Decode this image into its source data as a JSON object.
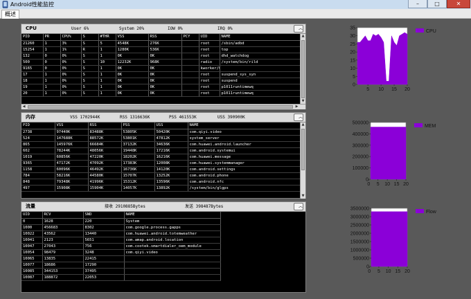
{
  "window": {
    "title": "Android性能监控",
    "btn_min": "–",
    "btn_max": "□",
    "btn_close": "✕"
  },
  "tabs": [
    {
      "label": "概述"
    }
  ],
  "cpu_panel": {
    "title": "CPU",
    "user": "User 6%",
    "system": "System 20%",
    "iow": "IOW 0%",
    "irq": "IRQ 0%",
    "columns": [
      "PID",
      "PR",
      "CPU%",
      "S",
      "#THR",
      "VSS",
      "RSS",
      "PCY",
      "UID",
      "NAME"
    ],
    "rows": [
      [
        "21260",
        "1",
        "3%",
        "S",
        "5",
        "4548K",
        "276K",
        "",
        "root",
        "/sbin/adbd"
      ],
      [
        "15254",
        "1",
        "1%",
        "R",
        "1",
        "1280K",
        "536K",
        "",
        "root",
        "top"
      ],
      [
        "132",
        "0",
        "0%",
        "S",
        "1",
        "0K",
        "0K",
        "",
        "root",
        "dhd_watchdog"
      ],
      [
        "500",
        "0",
        "0%",
        "S",
        "10",
        "12232K",
        "968K",
        "",
        "radio",
        "/system/bin/rild"
      ],
      [
        "9165",
        "0",
        "0%",
        "S",
        "1",
        "0K",
        "0K",
        "",
        "kworker/0:2",
        ""
      ],
      [
        "17",
        "1",
        "0%",
        "S",
        "1",
        "0K",
        "0K",
        "",
        "root",
        "suspend_sys_syn"
      ],
      [
        "18",
        "1",
        "0%",
        "S",
        "1",
        "0K",
        "0K",
        "",
        "root",
        "suspend"
      ],
      [
        "19",
        "1",
        "0%",
        "S",
        "1",
        "0K",
        "0K",
        "",
        "root",
        "p1011runtimewq"
      ],
      [
        "20",
        "1",
        "0%",
        "S",
        "1",
        "0K",
        "0K",
        "",
        "root",
        "p1011runtimewq"
      ]
    ]
  },
  "mem_panel": {
    "title": "内存",
    "vss": "VSS 1702944K",
    "rss": "RSS 1316636K",
    "pss": "PSS 461553K",
    "uss": "USS 390900K",
    "columns": [
      "PID",
      "VSS",
      "RSS",
      "PSS",
      "USS",
      "NAME"
    ],
    "rows": [
      [
        "2738",
        "97440K",
        "83488K",
        "53805K",
        "50420K",
        "com.qiyi.video"
      ],
      [
        "524",
        "147688K",
        "88572K",
        "53801K",
        "47812K",
        "system_server"
      ],
      [
        "865",
        "145976K",
        "66684K",
        "37132K",
        "34636K",
        "com.huawei.android.launcher"
      ],
      [
        "602",
        "78244K",
        "48056K",
        "19448K",
        "17216K",
        "com.android.systemui"
      ],
      [
        "1019",
        "60856K",
        "47220K",
        "18202K",
        "16216K",
        "com.huawei.message"
      ],
      [
        "9365",
        "47172K",
        "47092K",
        "17383K",
        "12008K",
        "com.huawei.systemmanager"
      ],
      [
        "1158",
        "60096K",
        "46492K",
        "16736K",
        "14120K",
        "com.android.settings"
      ],
      [
        "784",
        "58216K",
        "44580K",
        "15707K",
        "13252K",
        "com.android.phone"
      ],
      [
        "848",
        "79348K",
        "41996K",
        "15312K",
        "13596K",
        "com.android.nfc"
      ],
      [
        "497",
        "15908K",
        "15904K",
        "14057K",
        "13892K",
        "/system/bin/glgps"
      ]
    ]
  },
  "flow_panel": {
    "title": "流量",
    "recv": "接收 2910885Bytes",
    "send": "发送 398487Bytes",
    "columns": [
      "UID",
      "RCV",
      "SND",
      "NAME"
    ],
    "rows": [
      [
        "0",
        "1628",
        "220",
        "System"
      ],
      [
        "1000",
        "456683",
        "8302",
        "com.google.process.gapps"
      ],
      [
        "10022",
        "43562",
        "13440",
        "com.huawei.android.totemweather"
      ],
      [
        "10041",
        "2123",
        "5651",
        "com.amap.android.location"
      ],
      [
        "10047",
        "27043",
        "756",
        "com.cootek.smartdialer_oem_module"
      ],
      [
        "10054",
        "98479",
        "3248",
        "com.qiyi.video"
      ],
      [
        "10065",
        "13835",
        "22415",
        ""
      ],
      [
        "10077",
        "18686",
        "17290",
        ""
      ],
      [
        "10085",
        "344153",
        "37495",
        ""
      ],
      [
        "10087",
        "188872",
        "22053",
        ""
      ]
    ]
  },
  "chart_data": [
    {
      "type": "area",
      "legend": "CPU",
      "color": "#8b00d8",
      "x": [
        1,
        2,
        3,
        4,
        5,
        6,
        7,
        8,
        9,
        10,
        11,
        12,
        13,
        14,
        15,
        16,
        17,
        18,
        19,
        20
      ],
      "values": [
        26,
        26,
        28,
        30,
        27,
        27,
        31,
        30,
        31,
        29,
        26,
        2,
        2,
        30,
        26,
        24,
        30,
        31,
        32,
        31
      ],
      "xlim": [
        1,
        20
      ],
      "ylim": [
        0,
        35
      ],
      "xticks": [
        "5",
        "10",
        "15",
        "20"
      ],
      "yticks": [
        "0",
        "5",
        "10",
        "15",
        "20",
        "25",
        "30",
        "35"
      ],
      "legend_position": "right"
    },
    {
      "type": "area",
      "legend": "MEM",
      "color": "#8b00d8",
      "x": [
        1,
        2,
        3,
        4,
        5,
        6,
        7,
        8,
        9,
        10,
        11,
        12,
        13,
        14,
        15,
        16,
        17,
        18,
        19,
        20
      ],
      "values": [
        460000,
        460000,
        460000,
        460000,
        460000,
        460000,
        460000,
        460000,
        460000,
        460000,
        460000,
        460000,
        460000,
        460000,
        460000,
        460000,
        460000,
        460000,
        460000,
        460000
      ],
      "xlim": [
        1,
        20
      ],
      "ylim": [
        0,
        500000
      ],
      "xticks": [
        "0",
        "5",
        "10",
        "15",
        "20"
      ],
      "yticks": [
        "0",
        "100000",
        "200000",
        "300000",
        "400000",
        "500000"
      ],
      "legend_position": "right"
    },
    {
      "type": "area",
      "legend": "Flow",
      "color": "#8b00d8",
      "x": [
        1,
        2,
        3,
        4,
        5,
        6,
        7,
        8,
        9,
        10,
        11,
        12,
        13,
        14,
        15,
        16,
        17,
        18,
        19,
        20
      ],
      "values": [
        3300000,
        3300000,
        3300000,
        3300000,
        3300000,
        3300000,
        3300000,
        3300000,
        3300000,
        3300000,
        3300000,
        3300000,
        3300000,
        3300000,
        3300000,
        3300000,
        3300000,
        3300000,
        3300000,
        3300000
      ],
      "xlim": [
        1,
        20
      ],
      "ylim": [
        0,
        3500000
      ],
      "xticks": [
        "0",
        "5",
        "10",
        "15",
        "20"
      ],
      "yticks": [
        "0",
        "500000",
        "1000000",
        "1500000",
        "2000000",
        "2500000",
        "3000000",
        "3500000"
      ],
      "legend_position": "right"
    }
  ]
}
